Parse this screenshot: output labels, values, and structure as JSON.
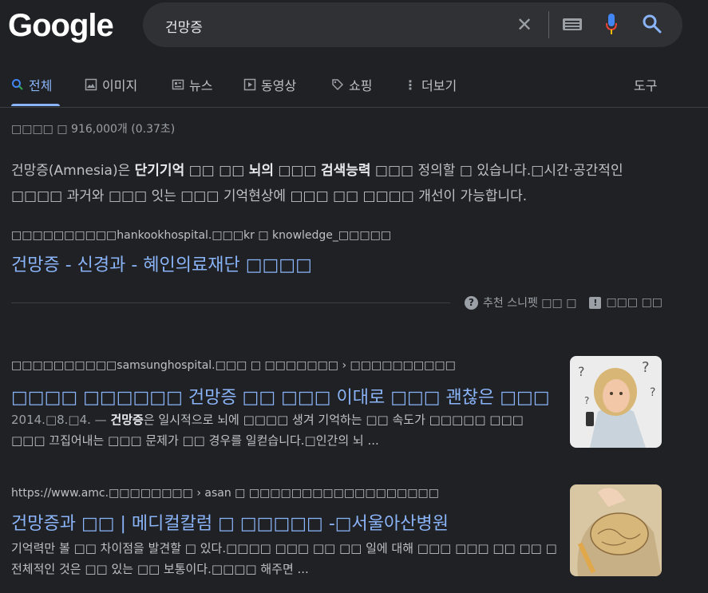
{
  "logo": "Google",
  "search": {
    "query": "건망증"
  },
  "tabs": [
    {
      "label": "전체",
      "icon": "search-icon"
    },
    {
      "label": "이미지",
      "icon": "image-icon"
    },
    {
      "label": "뉴스",
      "icon": "news-icon"
    },
    {
      "label": "동영상",
      "icon": "video-icon"
    },
    {
      "label": "쇼핑",
      "icon": "tag-icon"
    },
    {
      "label": "더보기",
      "icon": "more-icon"
    },
    {
      "label": "도구",
      "icon": ""
    }
  ],
  "stats": "□□□□ □ 916,000개 (0.37초)",
  "featured": {
    "snippet_parts": [
      "건망증(Amnesia)은 ",
      "단기기억",
      " □□ □□ ",
      "뇌의",
      " □□□ ",
      "검색능력",
      " □□□ 정의할 □ 있습니다.□시간·공간적인 □□□□ 과거와 □□□ 잇는 □□□ 기억현상에 □□□ □□ □□□□ 개선이 가능합니다."
    ],
    "cite": "□□□□□□□□□□hankookhospital.□□□kr □ knowledge_□□□□□",
    "title": "건망증 - 신경과 - 혜인의료재단 □□□□",
    "about_label": "추천 스니펫 □□ □",
    "feedback_label": "□□□ □□"
  },
  "results": [
    {
      "cite": "□□□□□□□□□□samsunghospital.□□□ □ □□□□□□□ › □□□□□□□□□□",
      "title": "□□□□ □□□□□□ 건망증 □□ □□□ 이대로 □□□ 괜찮은 □□□",
      "desc_date": "2014.□8.□4. — ",
      "desc_bold": "건망증",
      "desc_rest": "은 일시적으로 뇌에 □□□□ 생겨 기억하는 □□ 속도가 □□□□□ □□□ □□□ 끄집어내는 □□□ 문제가 □□ 경우를 일컫습니다.□인간의 뇌 ..."
    },
    {
      "cite": "https://www.amc.□□□□□□□□ › asan □ □□□□□□□□□□□□□□□□□□",
      "title": "건망증과 □□ | 메디컬칼럼 □ □□□□□ -□서울아산병원",
      "desc": "기억력만 볼 □□ 차이점을 발견할 □ 있다.□□□□ □□□ □□ □□ 일에 대해 □□□ □□□ □□ □□ □ 전체적인 것은 □□ 있는 □□ 보통이다.□□□□ 해주면 ..."
    }
  ]
}
